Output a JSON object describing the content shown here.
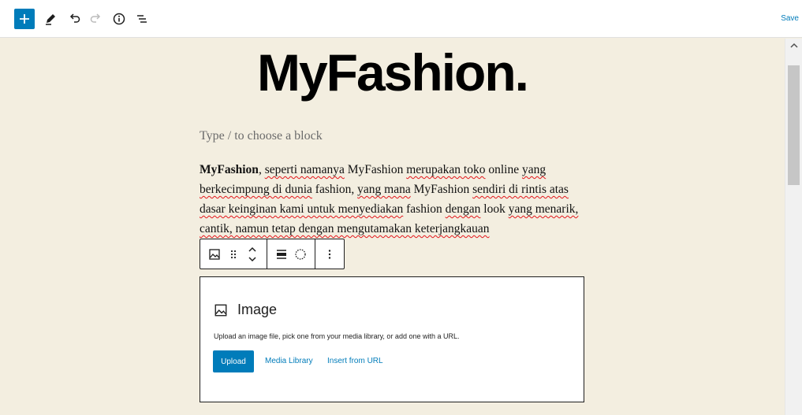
{
  "toolbar": {
    "add_label": "Add block",
    "save_label": "Save"
  },
  "scrollbar": {
    "position_fraction": 0.18
  },
  "editor": {
    "site_title": "MyFashion.",
    "block_placeholder": "Type / to choose a block",
    "paragraph": {
      "bold_word": "MyFashion",
      "segments": [
        {
          "text": ", ",
          "spell": false
        },
        {
          "text": "seperti namanya",
          "spell": true
        },
        {
          "text": " MyFashion ",
          "spell": false
        },
        {
          "text": "merupakan toko",
          "spell": true
        },
        {
          "text": " online ",
          "spell": false
        },
        {
          "text": "yang berkecimpung di dunia",
          "spell": true
        },
        {
          "text": " fashion, ",
          "spell": false
        },
        {
          "text": "yang mana",
          "spell": true
        },
        {
          "text": " MyFashion ",
          "spell": false
        },
        {
          "text": "sendiri di rintis atas dasar keinginan kami untuk menyediakan",
          "spell": true
        },
        {
          "text": " fashion ",
          "spell": false
        },
        {
          "text": "dengan",
          "spell": true
        },
        {
          "text": " look ",
          "spell": false
        },
        {
          "text": "yang menarik, cantik, namun tetap dengan mengutamakan keterjangkauan",
          "spell": true
        }
      ]
    }
  },
  "block_toolbar": {
    "icons": [
      "image-icon",
      "drag-handle-icon",
      "move-up-down-icon",
      "align-icon",
      "duotone-icon",
      "more-options-icon"
    ]
  },
  "image_block": {
    "title": "Image",
    "instructions": "Upload an image file, pick one from your media library, or add one with a URL.",
    "upload_label": "Upload",
    "media_library_label": "Media Library",
    "insert_url_label": "Insert from URL"
  }
}
